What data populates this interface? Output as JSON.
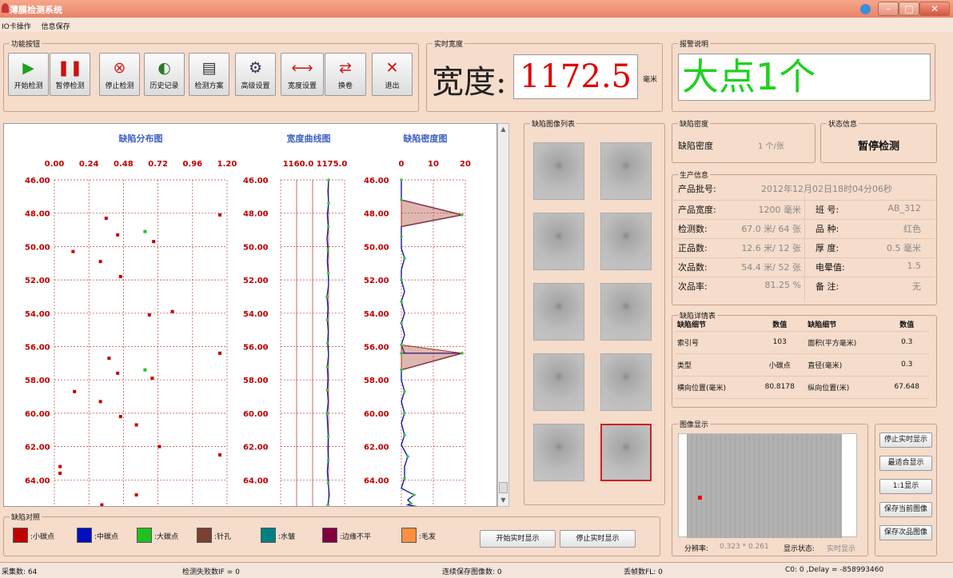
{
  "app": {
    "title": "薄膜检测系统",
    "menu": [
      "IO卡操作",
      "信息保存"
    ]
  },
  "toolbar": {
    "group_label": "功能按钮",
    "buttons": [
      {
        "label": "开始检测",
        "icon": "play-icon",
        "glyph": "▶",
        "color": "#1da31d"
      },
      {
        "label": "暂停检测",
        "icon": "pause-icon",
        "glyph": "❚❚",
        "color": "#cc1111"
      },
      {
        "label": "停止检测",
        "icon": "stop-circle-icon",
        "glyph": "⊗",
        "color": "#cc2222"
      },
      {
        "label": "历史记录",
        "icon": "history-icon",
        "glyph": "◐",
        "color": "#2a7a2a"
      },
      {
        "label": "检测方案",
        "icon": "document-icon",
        "glyph": "▤",
        "color": "#333"
      },
      {
        "label": "高级设置",
        "icon": "settings-icon",
        "glyph": "⚙",
        "color": "#335"
      },
      {
        "label": "宽度设置",
        "icon": "ruler-icon",
        "glyph": "⟷",
        "color": "#c22"
      },
      {
        "label": "换卷",
        "icon": "swap-icon",
        "glyph": "⇄",
        "color": "#d02020"
      },
      {
        "label": "退出",
        "icon": "close-icon",
        "glyph": "✕",
        "color": "#cc1111"
      }
    ]
  },
  "width": {
    "group_label": "实时宽度",
    "label": "宽度:",
    "value": "1172.5",
    "unit": "毫米"
  },
  "alarm": {
    "group_label": "报警说明",
    "text": "大点1个"
  },
  "density": {
    "group_label": "缺陷密度",
    "label": "缺陷密度",
    "value": "1 个/张"
  },
  "state": {
    "group_label": "状态信息",
    "text": "暂停检测"
  },
  "production": {
    "group_label": "生产信息",
    "batch_label": "产品批号:",
    "batch_value": "2012年12月02日18时04分06秒",
    "rows": [
      {
        "l": "产品宽度:",
        "v": "1200 毫米",
        "l2": "班  号:",
        "v2": "AB_312"
      },
      {
        "l": "检测数:",
        "v": "67.0 米/   64 张",
        "l2": "品  种:",
        "v2": "红色"
      },
      {
        "l": "正品数:",
        "v": "12.6 米/   12 张",
        "l2": "厚  度:",
        "v2": "0.5 毫米"
      },
      {
        "l": "次品数:",
        "v": "54.4 米/   52 张",
        "l2": "电晕值:",
        "v2": "1.5"
      },
      {
        "l": "次品率:",
        "v": "81.25 %",
        "l2": "备  注:",
        "v2": "无"
      }
    ]
  },
  "detail": {
    "group_label": "缺陷详情表",
    "headers": [
      "缺陷细节",
      "数值",
      "缺陷细节",
      "数值"
    ],
    "rows": [
      [
        "索引号",
        "103",
        "面积(平方毫米)",
        "0.3"
      ],
      [
        "类型",
        "小碳点",
        "直径(毫米)",
        "0.3"
      ],
      [
        "横向位置(毫米)",
        "80.8178",
        "纵向位置(米)",
        "67.648"
      ]
    ]
  },
  "image": {
    "group_label": "图像显示",
    "resolution_label": "分辨率:",
    "resolution_value": "0.323 * 0.261",
    "state_label": "显示状态:",
    "state_value": "实时显示",
    "buttons": [
      "停止实时显示",
      "最适合显示",
      "1:1显示",
      "保存当前图像",
      "保存次品图像"
    ]
  },
  "imagelist": {
    "group_label": "缺陷图像列表"
  },
  "legend": {
    "group_label": "缺陷对照",
    "items": [
      {
        "label": ":小碳点",
        "color": "#c00000"
      },
      {
        "label": ":中碳点",
        "color": "#0010c0"
      },
      {
        "label": ":大碳点",
        "color": "#20c020"
      },
      {
        "label": ":针孔",
        "color": "#7a4030"
      },
      {
        "label": ":水皱",
        "color": "#008080"
      },
      {
        "label": ":边缘不平",
        "color": "#800040"
      },
      {
        "label": ":毛发",
        "color": "#ff9040"
      }
    ],
    "start_btn": "开始实时显示",
    "stop_btn": "停止实时显示"
  },
  "status": {
    "s1": "采集数: 64",
    "s2": "检测失败数IF = 0",
    "s3": "连续保存图像数: 0",
    "s4": "丢帧数FL: 0",
    "s5": "C0: 0  ,Delay = -858993460"
  },
  "chart_data": [
    {
      "type": "scatter",
      "title": "缺陷分布图",
      "xticks": [
        "0.00",
        "0.24",
        "0.48",
        "0.72",
        "0.96",
        "1.20"
      ],
      "xlim": [
        0,
        1.2
      ],
      "yticks": [
        "46.00",
        "48.00",
        "50.00",
        "52.00",
        "54.00",
        "56.00",
        "58.00",
        "60.00",
        "62.00",
        "64.00"
      ],
      "ylim": [
        46,
        65.8
      ],
      "series": [
        {
          "name": "小碳点",
          "color": "#c00000",
          "points": [
            [
              0.36,
              48.3
            ],
            [
              0.44,
              49.3
            ],
            [
              0.69,
              49.7
            ],
            [
              0.13,
              50.3
            ],
            [
              0.32,
              50.9
            ],
            [
              0.46,
              51.8
            ],
            [
              0.66,
              54.1
            ],
            [
              0.82,
              53.9
            ],
            [
              1.15,
              48.1
            ],
            [
              0.38,
              56.7
            ],
            [
              0.44,
              57.6
            ],
            [
              0.68,
              57.9
            ],
            [
              0.14,
              58.7
            ],
            [
              0.32,
              59.3
            ],
            [
              0.46,
              60.2
            ],
            [
              0.57,
              60.7
            ],
            [
              0.73,
              62.0
            ],
            [
              0.04,
              63.2
            ],
            [
              0.04,
              63.6
            ],
            [
              0.57,
              64.9
            ],
            [
              1.15,
              62.5
            ],
            [
              1.15,
              56.4
            ],
            [
              0.33,
              65.5
            ]
          ]
        },
        {
          "name": "中碳点",
          "color": "#0010c0",
          "points": [
            [
              0.36,
              65.7
            ]
          ]
        },
        {
          "name": "大碳点",
          "color": "#20c020",
          "points": [
            [
              0.63,
              49.1
            ],
            [
              0.63,
              57.4
            ]
          ]
        }
      ]
    },
    {
      "type": "line",
      "title": "宽度曲线图",
      "xticks": [
        "1160.0",
        "1175.0"
      ],
      "xlim": [
        1160,
        1177.6
      ],
      "ylim": [
        46,
        65.8
      ],
      "series": [
        {
          "name": "宽度",
          "x": [
            1175,
            1174.8,
            1175,
            1174.6,
            1174.9,
            1174.5,
            1174.8,
            1174.6,
            1174.9,
            1175,
            1174.5,
            1174.8,
            1174.6,
            1174.9,
            1174.7,
            1175,
            1174.6,
            1174.8,
            1174.6,
            1174.9,
            1174.5,
            1174.7,
            1174.9,
            1174.8,
            1174.9,
            1174.6,
            1174.9,
            1175.2,
            1174.8,
            1174.8
          ],
          "y": [
            46,
            46.7,
            47.4,
            48.1,
            48.8,
            49.5,
            50.2,
            50.9,
            51.6,
            52.3,
            53,
            53.7,
            54.4,
            55.1,
            55.8,
            56.5,
            57.2,
            57.9,
            58.6,
            59.3,
            60,
            60.7,
            61.4,
            62.1,
            62.8,
            63.5,
            64.2,
            64.9,
            65.5,
            65.8
          ]
        }
      ]
    },
    {
      "type": "line",
      "title": "缺陷密度图",
      "xticks": [
        "0",
        "10",
        "20"
      ],
      "xlim": [
        0,
        20
      ],
      "ylim": [
        46,
        65.8
      ],
      "series": [
        {
          "name": "密度",
          "x": [
            0,
            0,
            0,
            19,
            19,
            0,
            0,
            0,
            1,
            0,
            0,
            1,
            0,
            1,
            0,
            1,
            0,
            1,
            0,
            2,
            19,
            19,
            0,
            0,
            1,
            0,
            1,
            0,
            1,
            0,
            2,
            1,
            1,
            0,
            4,
            2,
            3,
            2,
            8,
            19
          ],
          "y": [
            46,
            46.5,
            47.2,
            48.1,
            48.1,
            48.8,
            49.4,
            50.1,
            50.7,
            51.4,
            52,
            52.7,
            53.3,
            54,
            54.6,
            55.3,
            55.9,
            56.4,
            56.4,
            56.4,
            56.4,
            56.4,
            57.4,
            58,
            58.7,
            59.3,
            60,
            60.6,
            61.3,
            61.9,
            62.6,
            63.2,
            63.9,
            64.5,
            64.9,
            65.2,
            65.4,
            65.5,
            65.7,
            65.8
          ]
        }
      ]
    }
  ]
}
